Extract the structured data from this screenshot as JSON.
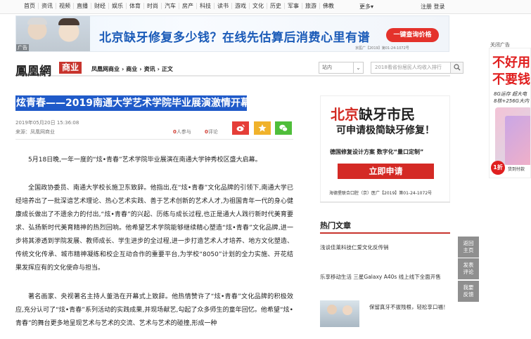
{
  "topnav": {
    "links": [
      "首页",
      "资讯",
      "视频",
      "直播",
      "财经",
      "娱乐",
      "体育",
      "时尚",
      "汽车",
      "房产",
      "科技",
      "读书",
      "游戏",
      "文化",
      "历史",
      "军事",
      "旅游",
      "佛教"
    ],
    "more": "更多▾",
    "login": "注册 登录"
  },
  "banner": {
    "headline": "北京缺牙修复多少钱？在线先估算后消费心里有谱",
    "button": "一键查询价格",
    "ad_tag": "广告",
    "fine": "京医广【2019】第01-24-1072号"
  },
  "side_ad": {
    "label": "关闭广告",
    "line1": "不好用",
    "line2": "不要钱",
    "spec1": "8G运存 超大电",
    "spec2": "8核+256G大内",
    "badge": "1折",
    "badge_sub": "货到付款"
  },
  "header": {
    "logo": "鳳凰網",
    "logo_tag": "商业",
    "breadcrumb": [
      "凤凰网商业",
      "商业",
      "资讯",
      "正文"
    ],
    "breadcrumb_sep": "›",
    "scope": "站内",
    "search_placeholder": "2018看省份居民人均收入排行"
  },
  "article": {
    "title": "炫青春——2019南通大学艺术学院毕业展演激情开幕",
    "date": "2019年05月20日 15:36:08",
    "source": "来源：凤凰网商业",
    "join_count": "0",
    "join_label": "人参与",
    "comment_count": "0",
    "comment_label": "评论",
    "paragraphs": [
      "5月18日晚,一年一度的“炫•青春”艺术学院毕业展演在南通大学钟秀校区盛大启幕。",
      "全国政协委员、南通大学校长施卫东致辞。他指出,在“炫•青春”文化品牌的引领下,南通大学已经培养出了一批深谙艺术理论、热心艺术实践、善于艺术创新的艺术人才,为祖国青年一代的身心健康成长做出了不遗余力的付出,“炫•青春”的兴起、历练与成长过程,也正是通大人践行新时代美育要求、弘扬新时代美育精神的热烈回响。他希望艺术学院能够继续精心塑造“炫•青春”文化品牌,进一步将其渗透到学院发展、教师成长、学生进步的全过程,进一步打造艺术人才培养、地方文化塑造、传统文化传承、城市精神凝练和校企互动合作的重要平台,为学校“8050”计划的全力实施、开花结果发挥应有的文化使命与担当。",
      "著名画家、央视著名主持人董浩在开幕式上致辞。他热情赞许了“炫•青春”文化品牌的积极效应,充分认可了“炫•青春”系列活动的实践成果,并现场献艺,勾起了众多师生的童年回忆。他希望“炫•青春”的舞台更多地呈现艺术与艺术的交流、艺术与艺术的碰撞,形成一种"
    ]
  },
  "right_ad": {
    "h1_red": "北京",
    "h1_black": "缺牙市民",
    "h2": "可申请极简缺牙修复！",
    "h3": "德国修复设计方案  数字化“量口定制”",
    "apply": "立即申请",
    "license": "海德堡联合口腔（京）医广【2019】第01-24-1072号"
  },
  "hot": {
    "title": "热门文章",
    "items": [
      "浅谈佳莱科技仁爱文化反传销",
      "乐享移动生活  三星Galaxy A40s 线上线下全面开售",
      "保留真牙不拔残根，轻松享口福！"
    ]
  },
  "float_buttons": [
    [
      "返回",
      "主页"
    ],
    [
      "发表",
      "评论"
    ],
    [
      "我要",
      "反馈"
    ]
  ]
}
